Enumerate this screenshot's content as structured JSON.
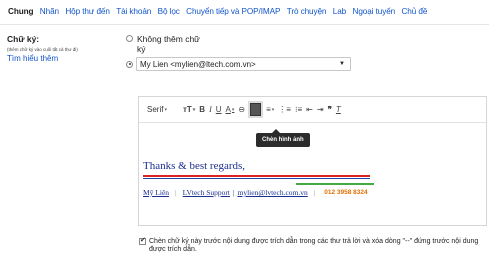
{
  "tabs": [
    "Chung",
    "Nhãn",
    "Hộp thư đến",
    "Tài khoản",
    "Bộ lọc",
    "Chuyển tiếp và POP/IMAP",
    "Trò chuyện",
    "Lab",
    "Ngoại tuyến",
    "Chủ đề"
  ],
  "signature": {
    "label": "Chữ ký:",
    "note": "(thêm chữ ký vào cuối tất cả thư đi)",
    "learn_more": "Tìm hiểu thêm",
    "no_signature_option": "Không thêm chữ ký",
    "selected_identity": "My Lien <mylien@ltech.com.vn>"
  },
  "editor": {
    "font": "Serif",
    "tooltip": "Chèn hình ảnh",
    "content": {
      "greeting": "Thanks & best regards,",
      "name": "Mỹ Liên",
      "company": "LVtech Support",
      "email": "mylien@lvtech.com.vn",
      "phone": "012 3958 8324"
    }
  },
  "checkbox": {
    "checked": true,
    "label": "Chèn chữ ký này trước nội dung được trích dẫn trong các thư trả lời và xóa dòng \"--\" đứng trước nội dung được trích dẫn."
  }
}
